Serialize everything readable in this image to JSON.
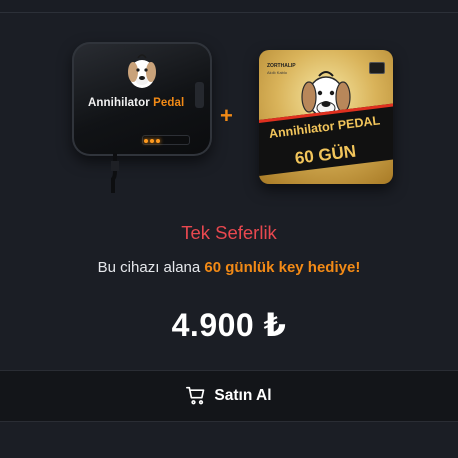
{
  "product": {
    "device_label_main": "Annihilator",
    "device_label_accent": "Pedal",
    "plus": "+",
    "gift_brand": "ZORTHALIP",
    "gift_brand_sub": "Akıllı Kablo",
    "gift_title": "Annihilator PEDAL",
    "gift_days": "60 GÜN"
  },
  "offer": {
    "plan_title": "Tek Seferlik",
    "promo_prefix": "Bu cihazı alana ",
    "promo_highlight": "60 günlük key hediye!",
    "price": "4.900 ₺"
  },
  "actions": {
    "buy_label": "Satın Al"
  },
  "colors": {
    "accent_orange": "#f28a16",
    "title_red": "#e8484f",
    "background": "#1b1e25"
  },
  "icons": {
    "buy": "shopping-cart-icon"
  }
}
